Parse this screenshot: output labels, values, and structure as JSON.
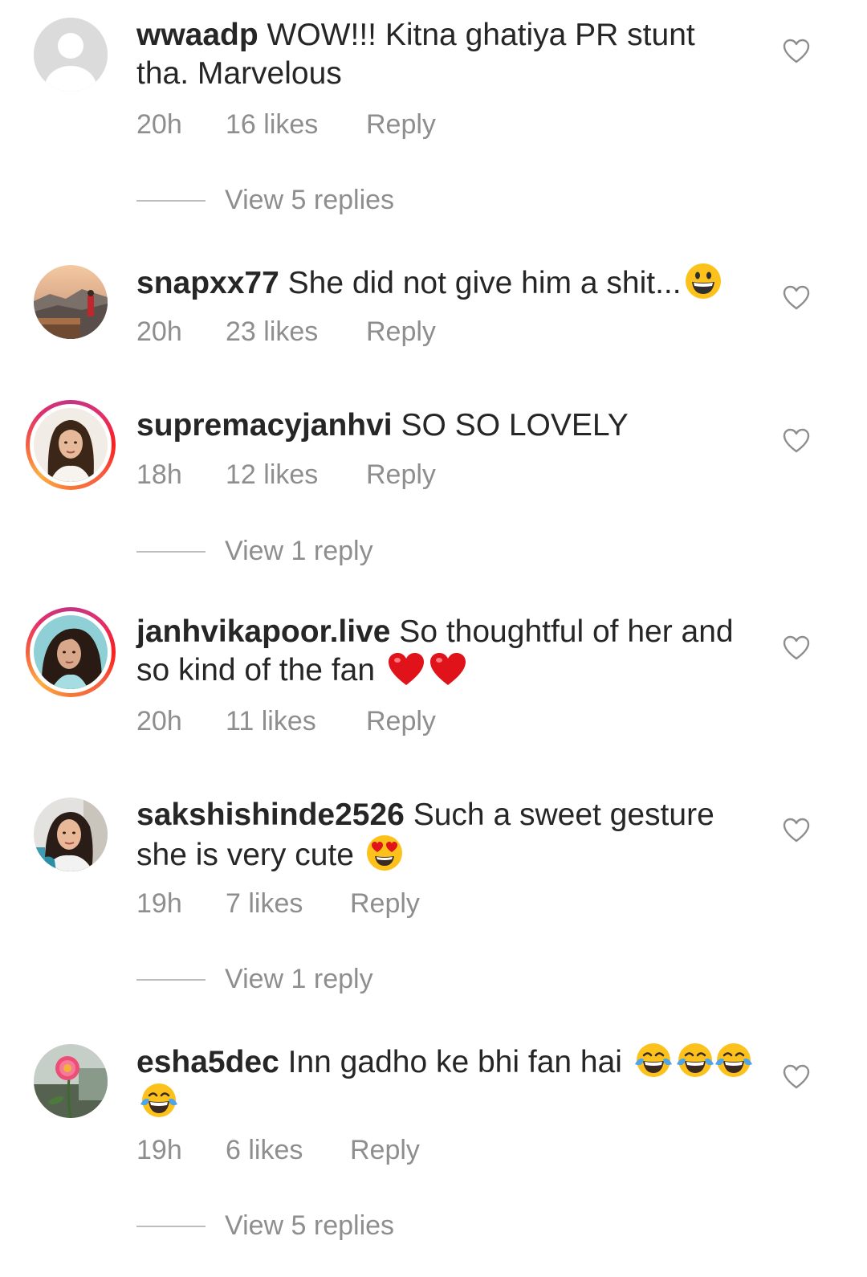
{
  "comments": [
    {
      "username": "wwaadp",
      "text": " WOW!!! Kitna ghatiya PR stunt tha. Marvelous",
      "time": "20h",
      "likes": "16 likes",
      "reply": "Reply",
      "view_replies": "View 5 replies",
      "avatar": "default-avatar-icon"
    },
    {
      "username": "snapxx77",
      "text": " She did not give him a shit...",
      "emoji": [
        "grinning-face"
      ],
      "time": "20h",
      "likes": "23 likes",
      "reply": "Reply",
      "avatar": "landscape-photo"
    },
    {
      "username": "supremacyjanhvi",
      "text": " SO SO LOVELY",
      "time": "18h",
      "likes": "12 likes",
      "reply": "Reply",
      "view_replies": "View 1 reply",
      "avatar": "portrait-photo-story"
    },
    {
      "username": "janhvikapoor.live",
      "text": " So thoughtful of her and so kind of the fan ",
      "emoji": [
        "red-heart",
        "red-heart"
      ],
      "time": "20h",
      "likes": "11 likes",
      "reply": "Reply",
      "avatar": "portrait-photo-story"
    },
    {
      "username": "sakshishinde2526",
      "text": " Such a sweet gesture she is very cute ",
      "emoji": [
        "heart-eyes-face"
      ],
      "time": "19h",
      "likes": "7 likes",
      "reply": "Reply",
      "view_replies": "View 1 reply",
      "avatar": "selfie-photo"
    },
    {
      "username": "esha5dec",
      "text": " Inn gadho ke bhi fan hai ",
      "emoji": [
        "tears-of-joy-face",
        "tears-of-joy-face",
        "tears-of-joy-face",
        "tears-of-joy-face"
      ],
      "time": "19h",
      "likes": "6 likes",
      "reply": "Reply",
      "view_replies": "View 5 replies",
      "avatar": "flower-photo"
    }
  ],
  "colors": {
    "text": "#262626",
    "muted": "#8e8e8e",
    "emoji_yellow": "#fcc21b",
    "heart_red": "#e0131b"
  }
}
